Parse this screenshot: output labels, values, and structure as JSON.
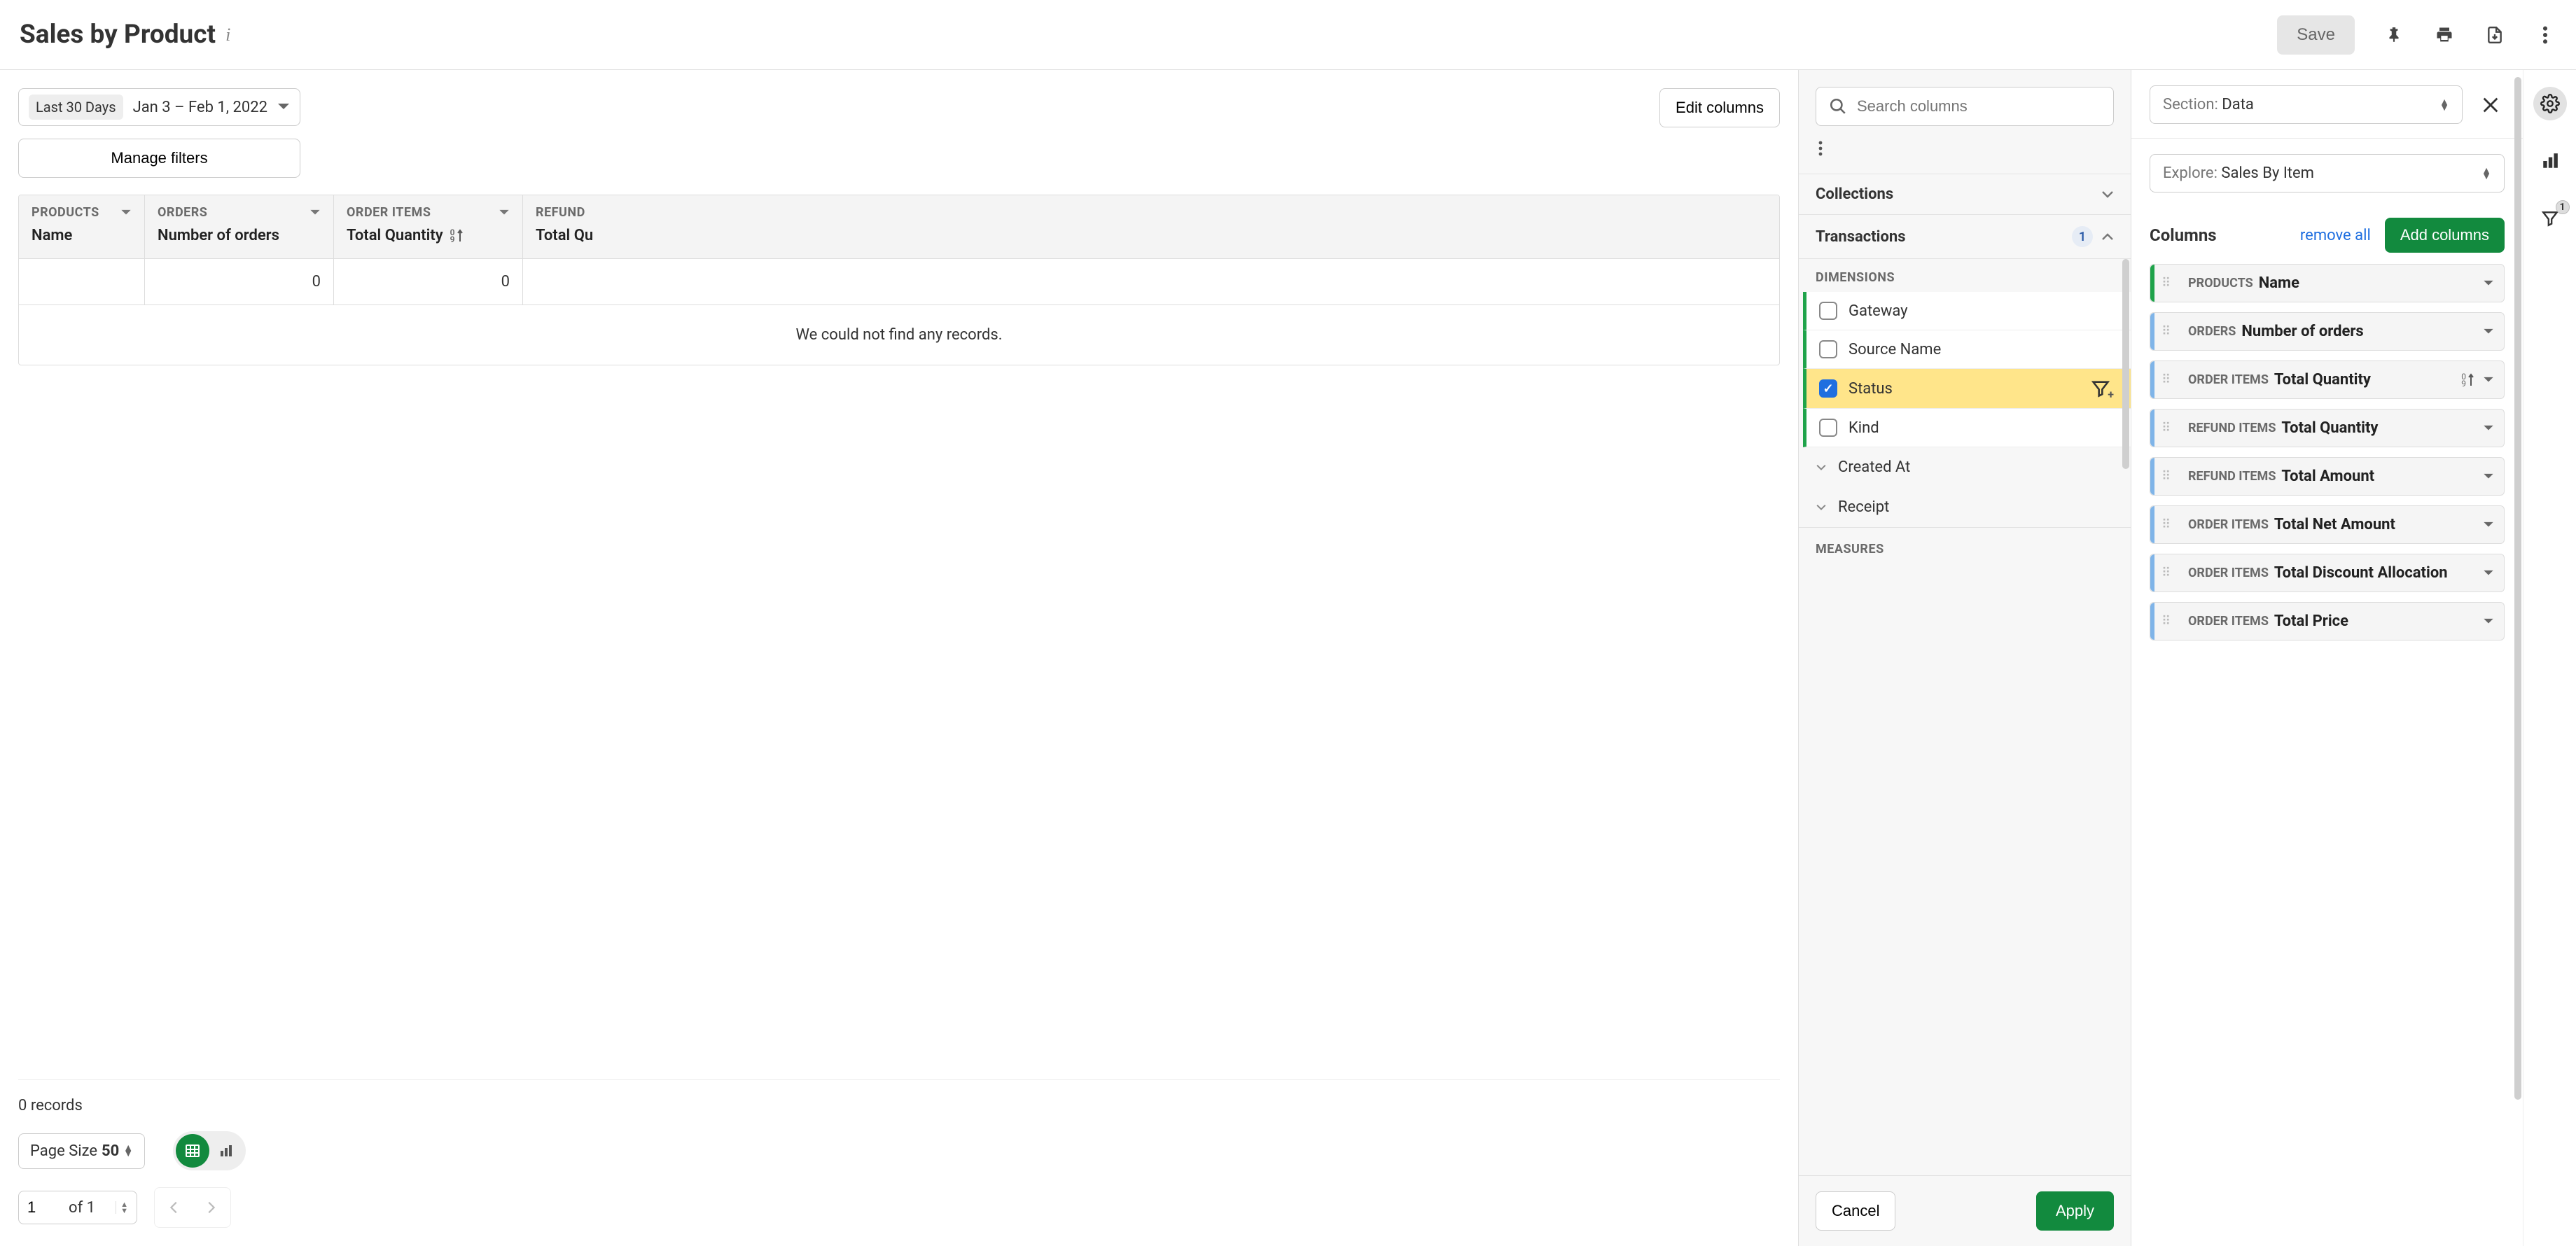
{
  "header": {
    "title": "Sales by Product",
    "save_label": "Save"
  },
  "filters": {
    "range_badge": "Last 30 Days",
    "range_text": "Jan 3 – Feb 1, 2022",
    "edit_columns": "Edit columns",
    "manage_filters": "Manage filters"
  },
  "table": {
    "columns": [
      {
        "group": "PRODUCTS",
        "name": "Name"
      },
      {
        "group": "ORDERS",
        "name": "Number of orders"
      },
      {
        "group": "ORDER ITEMS",
        "name": "Total Quantity",
        "sorted": true
      },
      {
        "group": "REFUND",
        "name": "Total Qu"
      }
    ],
    "row0": {
      "c1": "0",
      "c2": "0",
      "c3": ""
    },
    "empty_msg": "We could not find any records."
  },
  "footer": {
    "records": "0 records",
    "page_size_label": "Page Size",
    "page_size_value": "50",
    "page_input": "1",
    "page_of": "of 1"
  },
  "mid": {
    "search_placeholder": "Search columns",
    "sections": {
      "collections": "Collections",
      "transactions": "Transactions",
      "transactions_count": "1",
      "dimensions_label": "DIMENSIONS",
      "measures_label": "MEASURES"
    },
    "dims": {
      "gateway": "Gateway",
      "source_name": "Source Name",
      "status": "Status",
      "kind": "Kind",
      "created_at": "Created At",
      "receipt": "Receipt"
    },
    "cancel": "Cancel",
    "apply": "Apply"
  },
  "right": {
    "section_label": "Section:",
    "section_value": "Data",
    "explore_label": "Explore:",
    "explore_value": "Sales By Item",
    "columns_label": "Columns",
    "remove_all": "remove all",
    "add_columns": "Add columns",
    "items": [
      {
        "group": "PRODUCTS",
        "name": "Name",
        "color": "green"
      },
      {
        "group": "ORDERS",
        "name": "Number of orders",
        "color": "blue"
      },
      {
        "group": "ORDER ITEMS",
        "name": "Total Quantity",
        "color": "blue",
        "sorted": true
      },
      {
        "group": "REFUND ITEMS",
        "name": "Total Quantity",
        "color": "blue"
      },
      {
        "group": "REFUND ITEMS",
        "name": "Total Amount",
        "color": "blue"
      },
      {
        "group": "ORDER ITEMS",
        "name": "Total Net Amount",
        "color": "blue"
      },
      {
        "group": "ORDER ITEMS",
        "name": "Total Discount Allocation",
        "color": "blue"
      },
      {
        "group": "ORDER ITEMS",
        "name": "Total Price",
        "color": "blue"
      }
    ]
  },
  "rail": {
    "filter_count": "1"
  }
}
